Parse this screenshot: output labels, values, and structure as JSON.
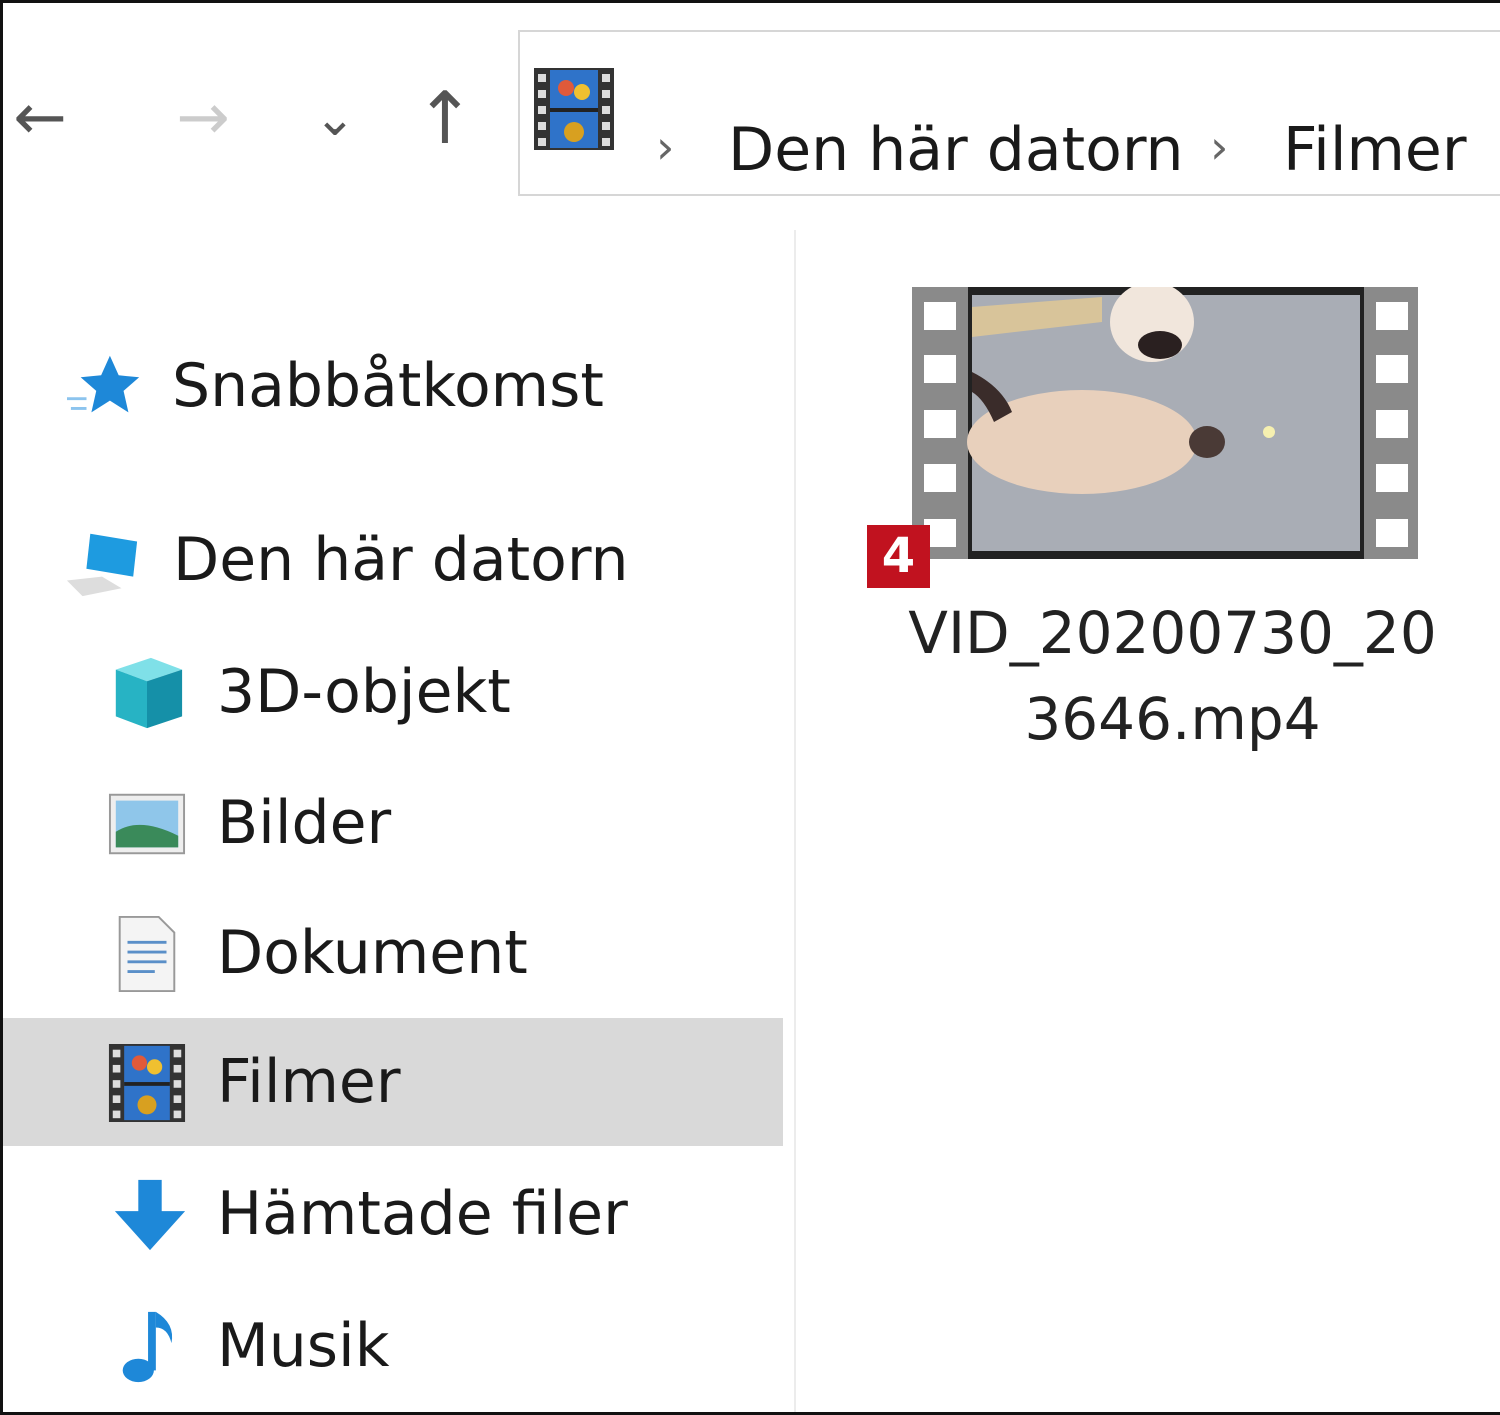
{
  "toolbar": {
    "back": "←",
    "forward": "→",
    "recent": "⌄",
    "up": "↑"
  },
  "address": {
    "crumbs": [
      "Den här datorn",
      "Filmer"
    ],
    "separator": "›"
  },
  "sidebar": {
    "items": [
      {
        "label": "Snabbåtkomst",
        "icon": "star-icon"
      },
      {
        "label": "Den här datorn",
        "icon": "computer-icon"
      },
      {
        "label": "3D-objekt",
        "icon": "cube-icon"
      },
      {
        "label": "Bilder",
        "icon": "pictures-icon"
      },
      {
        "label": "Dokument",
        "icon": "document-icon"
      },
      {
        "label": "Filmer",
        "icon": "film-icon",
        "selected": true
      },
      {
        "label": "Hämtade filer",
        "icon": "download-icon"
      },
      {
        "label": "Musik",
        "icon": "music-icon"
      }
    ]
  },
  "file": {
    "name_line1": "VID_20200730_20",
    "name_line2": "3646.mp4",
    "badge": "4"
  },
  "colors": {
    "badge": "#c1121f",
    "selected": "#d9d9d9",
    "accent": "#1e88d8"
  }
}
